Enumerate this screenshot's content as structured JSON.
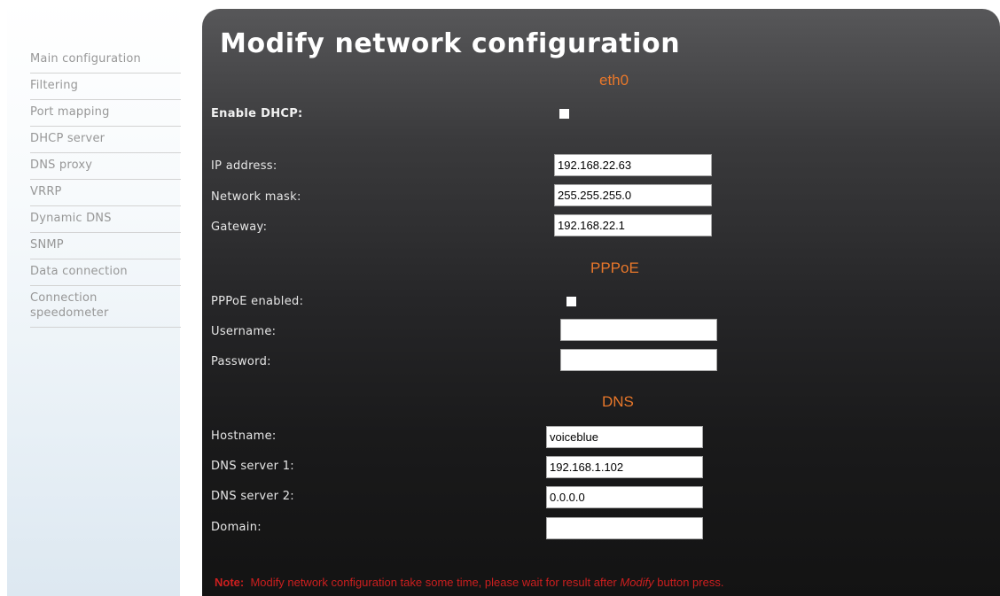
{
  "sidebar": {
    "items": [
      {
        "label": "Main configuration"
      },
      {
        "label": "Filtering"
      },
      {
        "label": "Port mapping"
      },
      {
        "label": "DHCP server"
      },
      {
        "label": "DNS proxy"
      },
      {
        "label": "VRRP"
      },
      {
        "label": "Dynamic DNS"
      },
      {
        "label": "SNMP"
      },
      {
        "label": "Data connection"
      },
      {
        "label": "Connection\nspeedometer"
      }
    ]
  },
  "page": {
    "title": "Modify network configuration"
  },
  "eth0": {
    "heading": "eth0",
    "dhcp_label": "Enable DHCP:",
    "ip_label": "IP address:",
    "ip_value": "192.168.22.63",
    "mask_label": "Network mask:",
    "mask_value": "255.255.255.0",
    "gateway_label": "Gateway:",
    "gateway_value": "192.168.22.1"
  },
  "pppoe": {
    "heading": "PPPoE",
    "enabled_label": "PPPoE enabled:",
    "username_label": "Username:",
    "username_value": "",
    "password_label": "Password:",
    "password_value": ""
  },
  "dns": {
    "heading": "DNS",
    "hostname_label": "Hostname:",
    "hostname_value": "voiceblue",
    "server1_label": "DNS server 1:",
    "server1_value": "192.168.1.102",
    "server2_label": "DNS server 2:",
    "server2_value": "0.0.0.0",
    "domain_label": "Domain:",
    "domain_value": ""
  },
  "note": {
    "prefix": "Note:",
    "text1": "Modify network configuration take some time, please wait for result after ",
    "emphasis": "Modify",
    "text2": " button press."
  },
  "colors": {
    "section_heading": "#e8772a",
    "note_text": "#cc1f1f",
    "menu_text": "#979797"
  }
}
